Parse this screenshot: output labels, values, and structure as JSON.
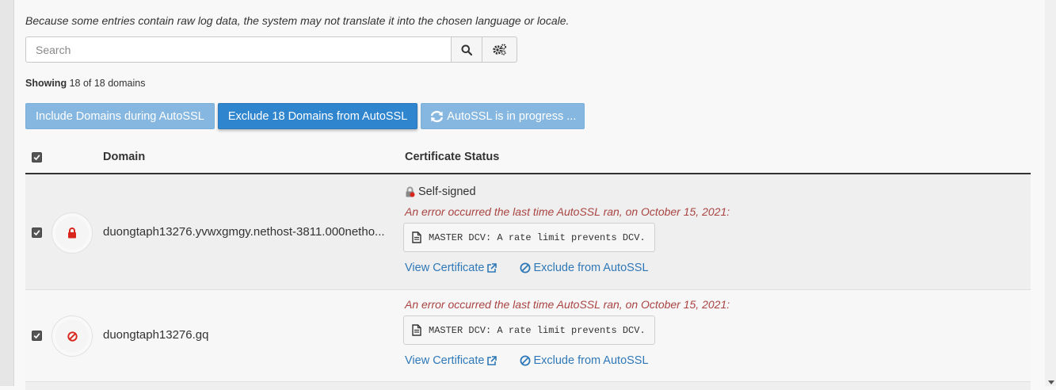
{
  "notice": "Because some entries contain raw log data, the system may not translate it into the chosen language or locale.",
  "search": {
    "placeholder": "Search",
    "value": ""
  },
  "showing": {
    "label": "Showing",
    "text": "18 of 18 domains"
  },
  "actions": {
    "include_label": "Include Domains during AutoSSL",
    "exclude_label": "Exclude 18 Domains from AutoSSL",
    "progress_label": "AutoSSL is in progress ..."
  },
  "table": {
    "headers": {
      "domain": "Domain",
      "status": "Certificate Status"
    },
    "rows": [
      {
        "domain": "duongtaph13276.yvwxgmgy.nethost-3811.000netho...",
        "status_icon": "lock-icon",
        "status_color": "#d9261c",
        "cert_type": "Self-signed",
        "error": "An error occurred the last time AutoSSL ran, on October 15, 2021:",
        "log": "MASTER DCV: A rate limit prevents DCV.",
        "view_link": "View Certificate",
        "exclude_link": "Exclude from AutoSSL"
      },
      {
        "domain": "duongtaph13276.gq",
        "status_icon": "ban-icon",
        "status_color": "#d9261c",
        "error": "An error occurred the last time AutoSSL ran, on October 15, 2021:",
        "log": "MASTER DCV: A rate limit prevents DCV.",
        "view_link": "View Certificate",
        "exclude_link": "Exclude from AutoSSL"
      }
    ]
  },
  "colors": {
    "primary": "#2f86cf",
    "primary_light": "#85b7e0",
    "error": "#a94442",
    "link": "#2f78b8",
    "danger_icon": "#d9261c"
  }
}
